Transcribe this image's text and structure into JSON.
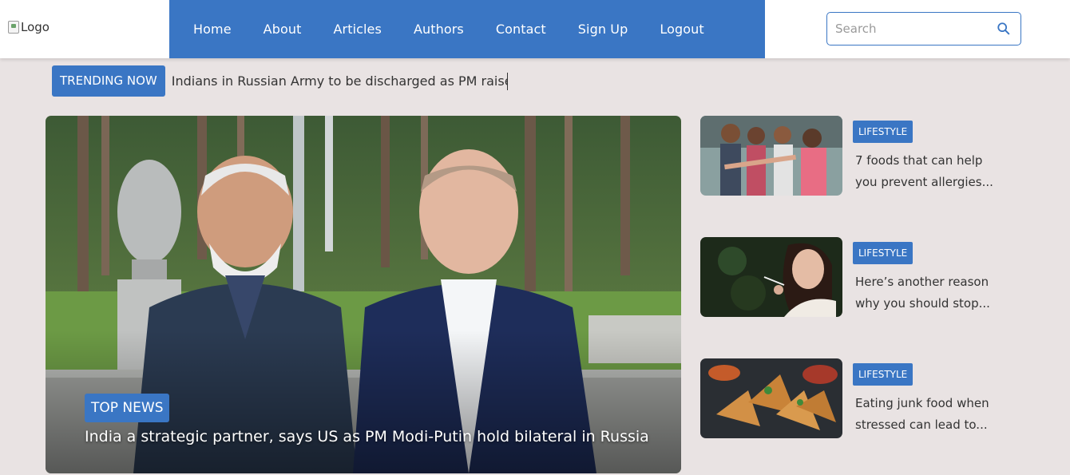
{
  "header": {
    "logo_alt": "Logo",
    "nav": [
      "Home",
      "About",
      "Articles",
      "Authors",
      "Contact",
      "Sign Up",
      "Logout"
    ],
    "search_placeholder": "Search"
  },
  "trending": {
    "label": "TRENDING NOW",
    "text": "Indians in Russian Army to be discharged as PM raise"
  },
  "hero": {
    "badge": "TOP NEWS",
    "title": "India a strategic partner, says US as PM Modi-Putin hold bilateral in Russia"
  },
  "side_articles": [
    {
      "category": "LIFESTYLE",
      "title": "7 foods that can help you prevent allergies..."
    },
    {
      "category": "LIFESTYLE",
      "title": "Here’s another reason why you should stop..."
    },
    {
      "category": "LIFESTYLE",
      "title": "Eating junk food when stressed can lead to..."
    }
  ],
  "colors": {
    "accent": "#3a76c4",
    "background": "#e9e3e3"
  }
}
